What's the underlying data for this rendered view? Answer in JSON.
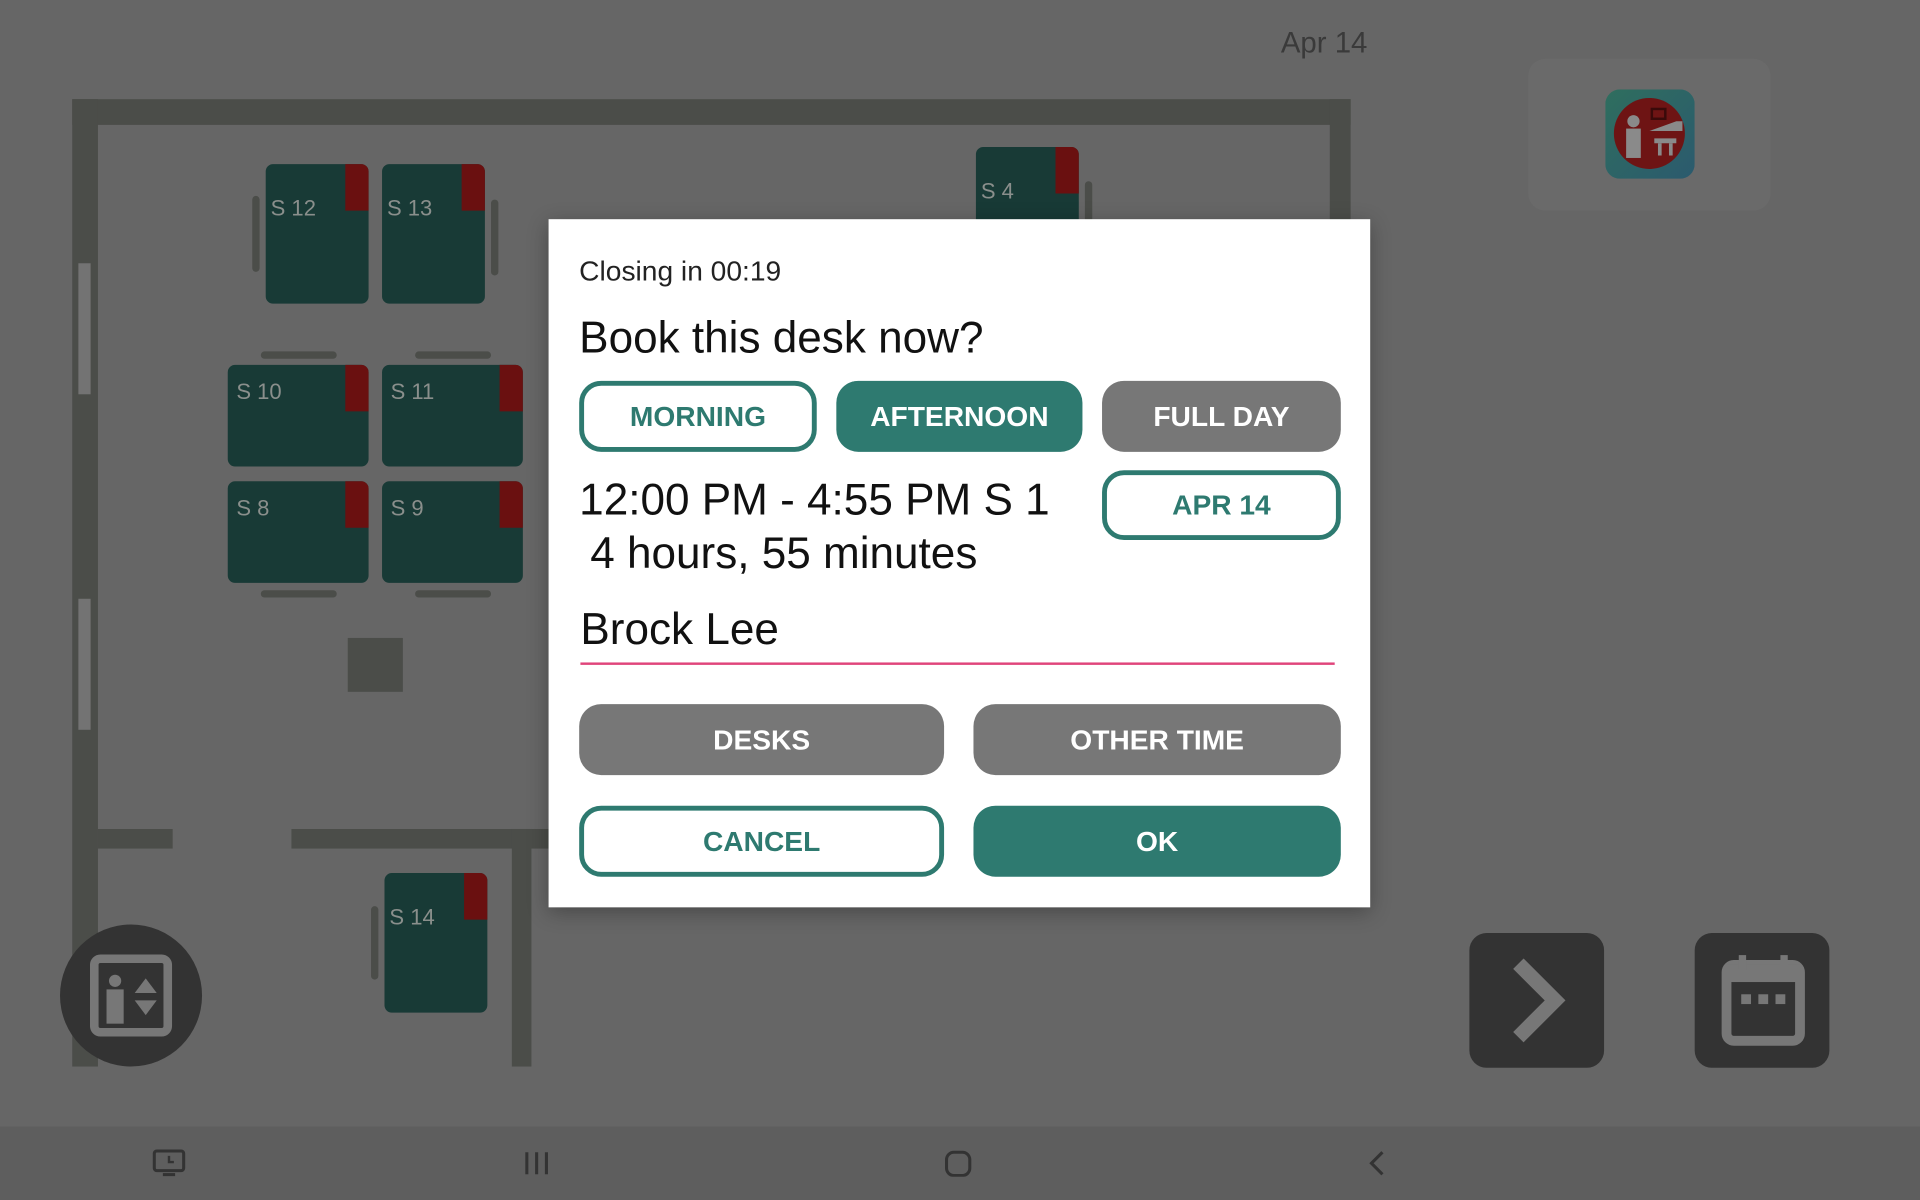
{
  "header": {
    "date": "Apr 14"
  },
  "floor": {
    "desks": [
      {
        "label": "S 12"
      },
      {
        "label": "S 13"
      },
      {
        "label": "S 4"
      },
      {
        "label": "S 10"
      },
      {
        "label": "S 11"
      },
      {
        "label": "S 8"
      },
      {
        "label": "S 9"
      },
      {
        "label": "S 14"
      }
    ]
  },
  "dialog": {
    "countdown": "Closing in 00:19",
    "title": "Book this desk now?",
    "period_buttons": {
      "morning": "MORNING",
      "afternoon": "AFTERNOON",
      "full_day": "FULL DAY"
    },
    "selected_period": "AFTERNOON",
    "time_range": "12:00 PM - 4:55 PM S 1",
    "duration": "4 hours, 55 minutes",
    "date_button": "APR 14",
    "name_value": "Brock Lee",
    "desks_button": "DESKS",
    "other_time_button": "OTHER TIME",
    "cancel_button": "CANCEL",
    "ok_button": "OK"
  },
  "colors": {
    "accent": "#2e7a70",
    "underline": "#e0457b",
    "desk_occupied": "#8b0000"
  },
  "icons": {
    "app": "presentation-room-icon",
    "elevator": "elevator-icon",
    "next": "chevron-right-icon",
    "calendar": "calendar-icon",
    "nav": [
      "screen-clock-icon",
      "recent-apps-icon",
      "home-icon",
      "back-icon"
    ]
  }
}
